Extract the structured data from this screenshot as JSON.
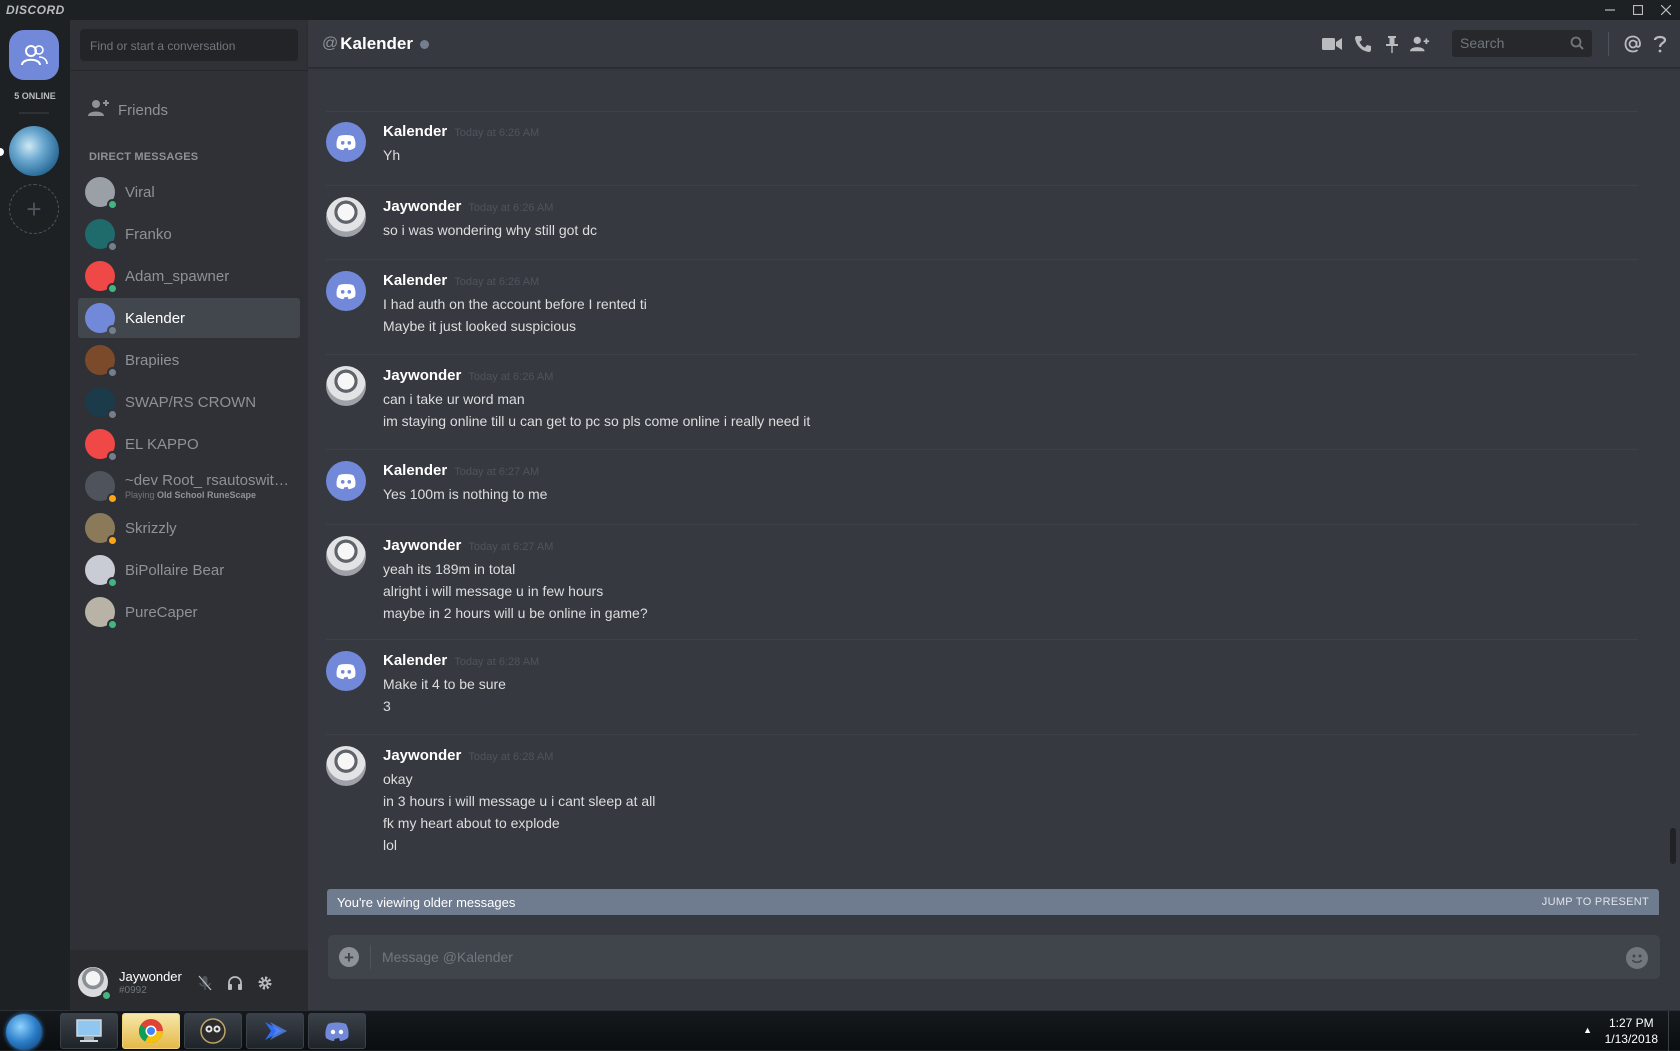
{
  "app": {
    "brand": "DISCORD"
  },
  "guilds": {
    "online_count": "5 ONLINE"
  },
  "sidebar": {
    "search_placeholder": "Find or start a conversation",
    "friends_label": "Friends",
    "dm_header": "DIRECT MESSAGES",
    "dms": [
      {
        "name": "Viral",
        "status": "online",
        "status_color": "#43b581",
        "avatar_color": "#9aa0a6",
        "activity": "",
        "activity_game": ""
      },
      {
        "name": "Franko",
        "status": "offline",
        "status_color": "#747f8d",
        "avatar_color": "#1f6a6a",
        "activity": "",
        "activity_game": ""
      },
      {
        "name": "Adam_spawner",
        "status": "online",
        "status_color": "#43b581",
        "avatar_color": "#f04747",
        "activity": "",
        "activity_game": ""
      },
      {
        "name": "Kalender",
        "status": "offline",
        "status_color": "#747f8d",
        "avatar_color": "#7289da",
        "activity": "",
        "activity_game": ""
      },
      {
        "name": "Brapiies",
        "status": "offline",
        "status_color": "#747f8d",
        "avatar_color": "#7a4a2a",
        "activity": "",
        "activity_game": ""
      },
      {
        "name": "SWAP/RS CROWN",
        "status": "offline",
        "status_color": "#747f8d",
        "avatar_color": "#1b3a4a",
        "activity": "",
        "activity_game": ""
      },
      {
        "name": "EL KAPPO",
        "status": "offline",
        "status_color": "#747f8d",
        "avatar_color": "#f04747",
        "activity": "",
        "activity_game": ""
      },
      {
        "name": "~dev Root_ rsautoswitch...",
        "status": "idle",
        "status_color": "#faa61a",
        "avatar_color": "#4f545c",
        "activity": "Playing",
        "activity_game": "Old School RuneScape"
      },
      {
        "name": "Skrizzly",
        "status": "idle",
        "status_color": "#faa61a",
        "avatar_color": "#8a7a5a",
        "activity": "",
        "activity_game": ""
      },
      {
        "name": "BiPollaire Bear",
        "status": "online",
        "status_color": "#43b581",
        "avatar_color": "#c9ccd4",
        "activity": "",
        "activity_game": ""
      },
      {
        "name": "PureCaper",
        "status": "online",
        "status_color": "#43b581",
        "avatar_color": "#b8b3a6",
        "activity": "",
        "activity_game": ""
      }
    ],
    "active_dm": "Kalender"
  },
  "user": {
    "name": "Jaywonder",
    "tag": "#0992"
  },
  "header": {
    "at": "@",
    "channel_name": "Kalender",
    "search_placeholder": "Search"
  },
  "messages": [
    {
      "author": "Kalender",
      "time": "Today at 6:26 AM",
      "avatar": "discord",
      "lines": [
        "Yh"
      ]
    },
    {
      "author": "Jaywonder",
      "time": "Today at 6:26 AM",
      "avatar": "jay",
      "lines": [
        "so i was wondering why still got dc"
      ]
    },
    {
      "author": "Kalender",
      "time": "Today at 6:26 AM",
      "avatar": "discord",
      "lines": [
        "I had auth on the account before I rented ti",
        "Maybe it just looked suspicious"
      ]
    },
    {
      "author": "Jaywonder",
      "time": "Today at 6:26 AM",
      "avatar": "jay",
      "lines": [
        "can i take ur word man",
        "im staying online till u can get to pc so pls come online i really need it"
      ]
    },
    {
      "author": "Kalender",
      "time": "Today at 6:27 AM",
      "avatar": "discord",
      "lines": [
        "Yes 100m is nothing to me"
      ]
    },
    {
      "author": "Jaywonder",
      "time": "Today at 6:27 AM",
      "avatar": "jay",
      "lines": [
        "yeah its 189m in total",
        "alright i will message u in few hours",
        "maybe in 2 hours will u be online in game?"
      ]
    },
    {
      "author": "Kalender",
      "time": "Today at 6:28 AM",
      "avatar": "discord",
      "lines": [
        "Make it 4 to be sure",
        "3"
      ]
    },
    {
      "author": "Jaywonder",
      "time": "Today at 6:28 AM",
      "avatar": "jay",
      "lines": [
        "okay",
        "in 3 hours i will message u i cant sleep at all",
        "fk my heart about to explode",
        "lol"
      ]
    }
  ],
  "older_bar": {
    "text": "You're viewing older messages",
    "jump_label": "JUMP TO PRESENT"
  },
  "composer": {
    "placeholder": "Message @Kalender"
  },
  "taskbar": {
    "time": "1:27 PM",
    "date": "1/13/2018"
  }
}
